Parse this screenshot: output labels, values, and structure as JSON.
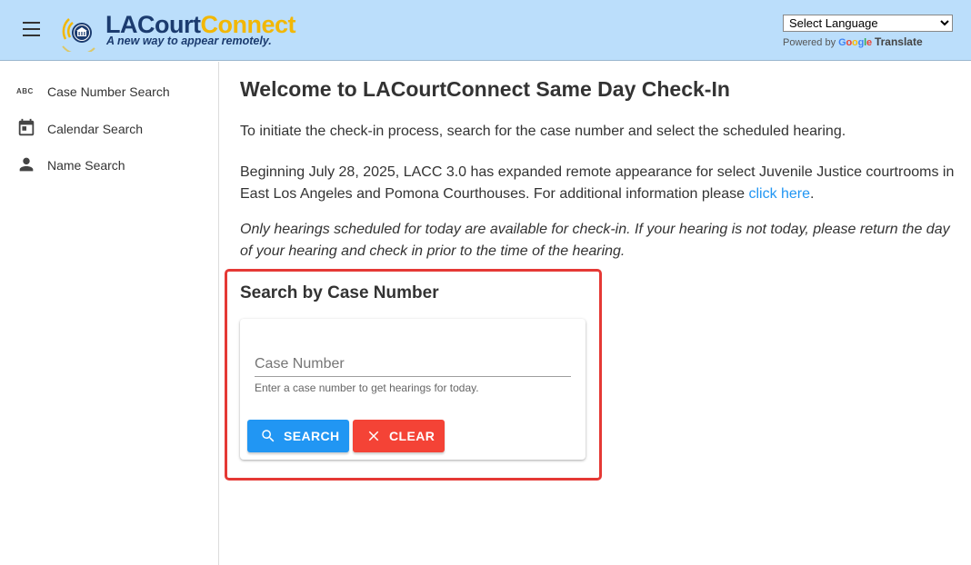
{
  "header": {
    "logo": {
      "brand_part1": "LACourt",
      "brand_part2": "Connect",
      "tagline": "A new way to appear remotely."
    },
    "language_select": {
      "selected": "Select Language"
    },
    "powered_by": {
      "prefix": "Powered by",
      "google": "Google",
      "translate": "Translate"
    }
  },
  "sidebar": {
    "items": [
      {
        "label": "Case Number Search",
        "icon": "abc-icon"
      },
      {
        "label": "Calendar Search",
        "icon": "calendar-icon"
      },
      {
        "label": "Name Search",
        "icon": "person-icon"
      }
    ],
    "abc_icon_text": "ABC"
  },
  "main": {
    "title": "Welcome to LACourtConnect Same Day Check-In",
    "intro": "To initiate the check-in process, search for the case number and select the scheduled hearing.",
    "notice_text": "Beginning July 28, 2025, LACC 3.0 has expanded remote appearance for select Juvenile Justice courtrooms in East Los Angeles and Pomona Courthouses. For additional information please ",
    "notice_link": "click here",
    "notice_end": ".",
    "italic_note": "Only hearings scheduled for today are available for check-in. If your hearing is not today, please return the day of your hearing and check in prior to the time of the hearing."
  },
  "search": {
    "heading": "Search by Case Number",
    "input_placeholder": "Case Number",
    "input_value": "",
    "hint": "Enter a case number to get hearings for today.",
    "search_label": "SEARCH",
    "clear_label": "CLEAR"
  },
  "colors": {
    "header_bg": "#bbdefb",
    "brand_dark": "#1b3b6f",
    "brand_yellow": "#f2b705",
    "link": "#2196f3",
    "search_button": "#2196f3",
    "clear_button": "#f44336",
    "highlight_border": "#e53935"
  }
}
